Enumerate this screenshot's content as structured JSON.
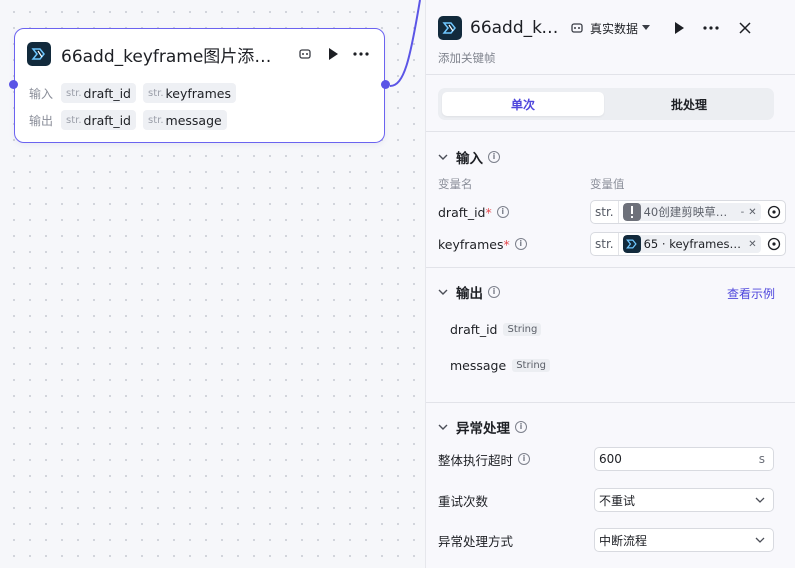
{
  "node": {
    "title": "66add_keyframe图片添加关…",
    "inputs_label": "输入",
    "outputs_label": "输出",
    "inputs": [
      {
        "type": "str.",
        "name": "draft_id"
      },
      {
        "type": "str.",
        "name": "keyframes"
      }
    ],
    "outputs": [
      {
        "type": "str.",
        "name": "draft_id"
      },
      {
        "type": "str.",
        "name": "message"
      }
    ]
  },
  "panel": {
    "title": "66add_ke…",
    "data_mode": "真实数据",
    "description": "添加关键帧",
    "tabs": [
      {
        "label": "单次",
        "active": true
      },
      {
        "label": "批处理",
        "active": false
      }
    ],
    "input_section": {
      "title": "输入",
      "col_name": "变量名",
      "col_value": "变量值",
      "rows": [
        {
          "name": "draft_id",
          "type": "str.",
          "ref": "40创建剪映草…",
          "ref_suffix": "-",
          "ref_icon": "warning-icon"
        },
        {
          "name": "keyframes",
          "type": "str.",
          "ref": "65 · keyframes_…",
          "ref_suffix": "",
          "ref_icon": "plugin-logo-icon"
        }
      ]
    },
    "output_section": {
      "title": "输出",
      "link": "查看示例",
      "rows": [
        {
          "name": "draft_id",
          "type": "String"
        },
        {
          "name": "message",
          "type": "String"
        }
      ]
    },
    "error_section": {
      "title": "异常处理",
      "timeout_label": "整体执行超时",
      "timeout_value": "600",
      "timeout_unit": "s",
      "retry_label": "重试次数",
      "retry_value": "不重试",
      "mode_label": "异常处理方式",
      "mode_value": "中断流程"
    }
  },
  "colors": {
    "accent": "#5b55e6",
    "link": "#4e46dc",
    "required": "#e5484d",
    "logo_bg": "#122a3c",
    "warning_bg": "#6e717a"
  }
}
